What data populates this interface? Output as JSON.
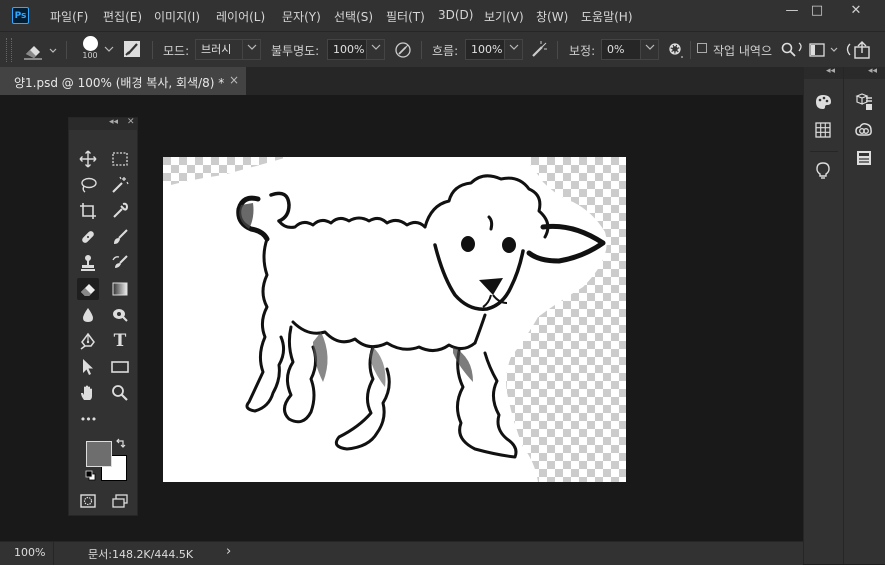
{
  "app": {
    "logo_text": "Ps"
  },
  "menu": [
    {
      "label": "파일(F)"
    },
    {
      "label": "편집(E)"
    },
    {
      "label": "이미지(I)"
    },
    {
      "label": "레이어(L)"
    },
    {
      "label": "문자(Y)"
    },
    {
      "label": "선택(S)"
    },
    {
      "label": "필터(T)"
    },
    {
      "label": "3D(D)"
    },
    {
      "label": "보기(V)"
    },
    {
      "label": "창(W)"
    },
    {
      "label": "도움말(H)"
    }
  ],
  "window_controls": {
    "minimize": "—",
    "maximize": "□",
    "close": "✕"
  },
  "options": {
    "brush_size": "100",
    "mode_label": "모드:",
    "mode_value": "브러시",
    "opacity_label": "불투명도:",
    "opacity_value": "100%",
    "flow_label": "흐름:",
    "flow_value": "100%",
    "smoothing_label": "보정:",
    "smoothing_value": "0%",
    "history_checkbox_label": "작업 내역으"
  },
  "document_tab": {
    "title": "양1.psd @ 100% (배경 복사, 회색/8) *",
    "close": "×"
  },
  "status": {
    "zoom": "100%",
    "doc_info": "문서:148.2K/444.5K",
    "arrow": "›"
  },
  "icons": {
    "eraser": "eraser-icon",
    "move": "move-icon",
    "marquee": "marquee-icon",
    "lasso": "lasso-icon",
    "magic_wand": "magic-wand-icon",
    "crop": "crop-icon",
    "eyedropper": "eyedropper-icon",
    "healing": "healing-brush-icon",
    "brush": "brush-icon",
    "stamp": "clone-stamp-icon",
    "history_brush": "history-brush-icon",
    "gradient": "gradient-icon",
    "blur": "blur-icon",
    "dodge": "dodge-icon",
    "pen": "pen-icon",
    "type": "type-icon",
    "path_select": "path-selection-icon",
    "rectangle": "rectangle-icon",
    "hand": "hand-icon",
    "zoom": "zoom-icon",
    "more": "more-tools-icon",
    "swap": "swap-colors-icon",
    "default_colors": "default-colors-icon",
    "quick_mask": "quick-mask-icon",
    "screen_mode": "screen-mode-icon"
  },
  "tools_panel": {
    "type_glyph": "T",
    "more_glyph": "•••"
  },
  "colors": {
    "foreground": "#6e6e6e",
    "background": "#ffffff",
    "accent": "#31a8ff"
  }
}
